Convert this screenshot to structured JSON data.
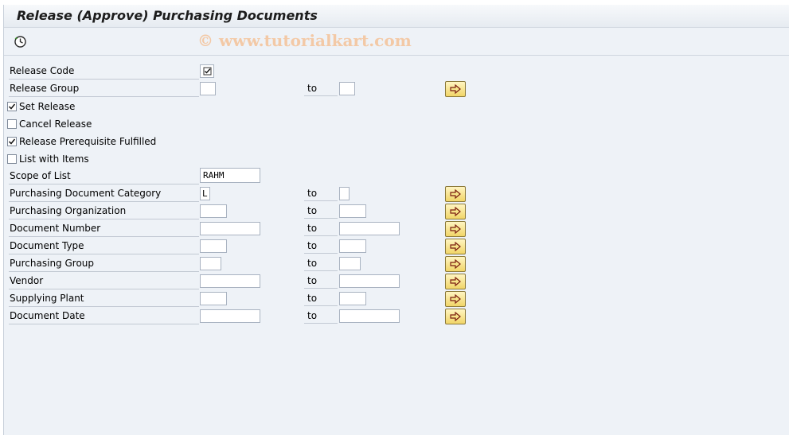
{
  "window": {
    "title": "Release (Approve) Purchasing Documents"
  },
  "toolbar": {
    "execute_icon": "execute-clock-icon",
    "watermark": "© www.tutorialkart.com"
  },
  "to_label": "to",
  "release_code": {
    "label": "Release Code",
    "checked": true
  },
  "release_group": {
    "label": "Release Group",
    "from": "",
    "to": ""
  },
  "options": [
    {
      "label": "Set Release",
      "checked": true
    },
    {
      "label": "Cancel Release",
      "checked": false
    },
    {
      "label": "Release Prerequisite Fulfilled",
      "checked": true
    },
    {
      "label": "List with Items",
      "checked": false
    }
  ],
  "scope_of_list": {
    "label": "Scope of List",
    "value": "RAHM"
  },
  "ranges": [
    {
      "label": "Purchasing Document Category",
      "from": "L",
      "to": ""
    },
    {
      "label": "Purchasing Organization",
      "from": "",
      "to": ""
    },
    {
      "label": "Document Number",
      "from": "",
      "to": ""
    },
    {
      "label": "Document Type",
      "from": "",
      "to": ""
    },
    {
      "label": "Purchasing Group",
      "from": "",
      "to": ""
    },
    {
      "label": "Vendor",
      "from": "",
      "to": ""
    },
    {
      "label": "Supplying Plant",
      "from": "",
      "to": ""
    },
    {
      "label": "Document Date",
      "from": "",
      "to": ""
    }
  ],
  "colors": {
    "frame": "#eef2f7",
    "button": "#f1d568",
    "arrow": "#7a1d10"
  }
}
